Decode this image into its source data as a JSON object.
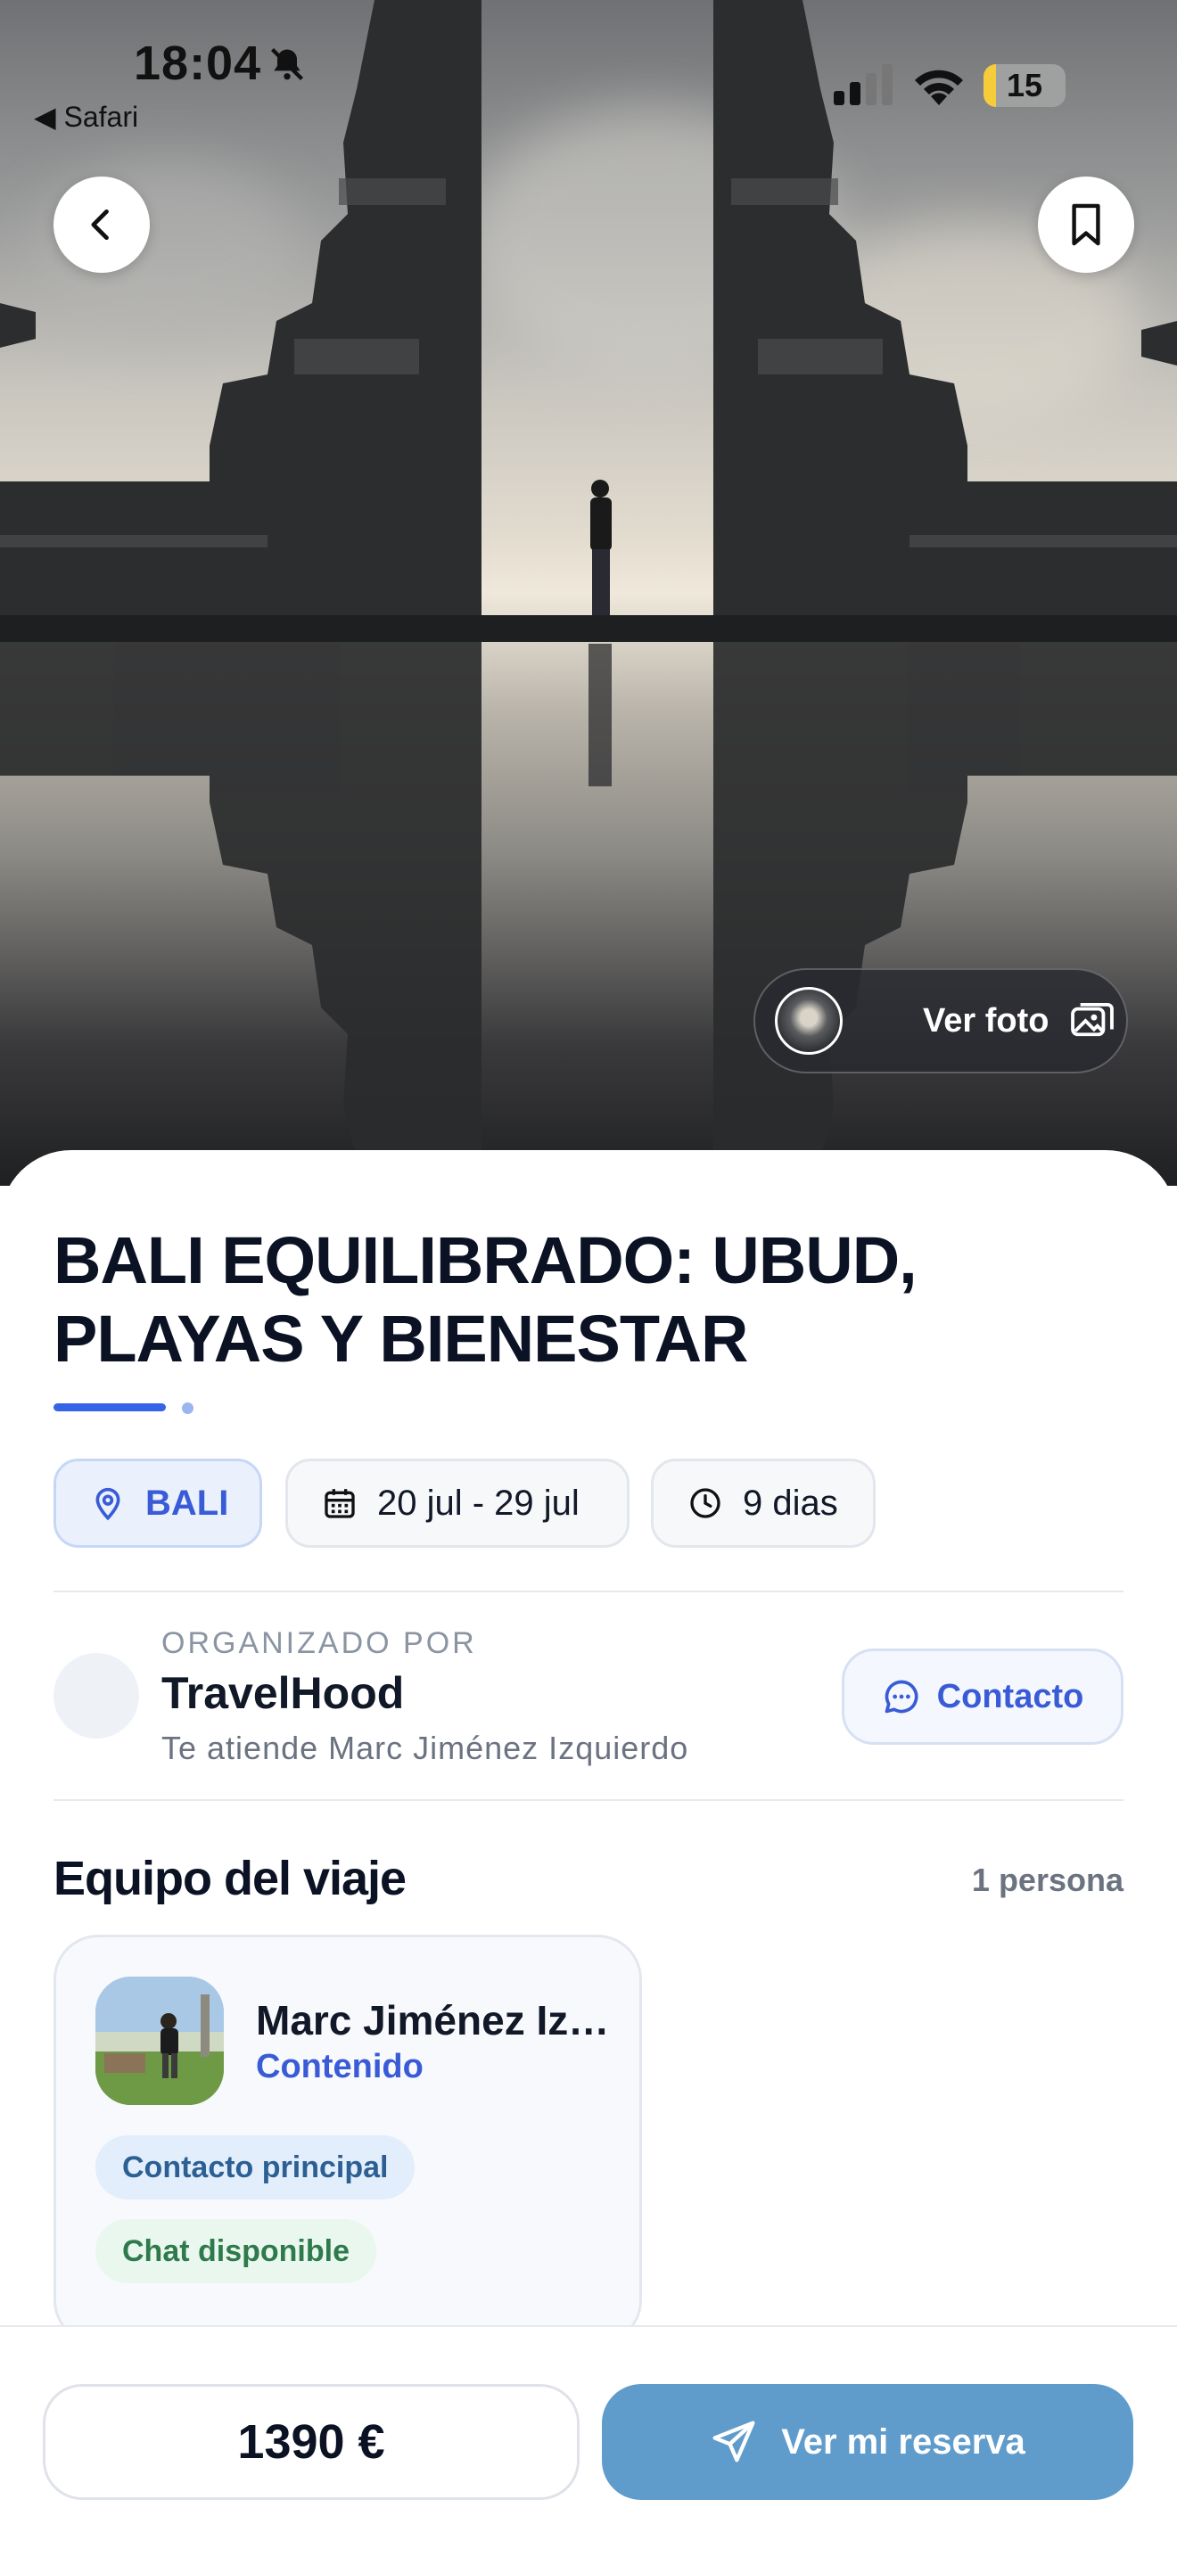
{
  "status_bar": {
    "time": "18:04",
    "back_app": "◀ Safari",
    "battery": "15",
    "battery_level": 0.15
  },
  "hero": {
    "photo_button_label": "Ver foto"
  },
  "trip": {
    "title": "BALI EQUILIBRADO: UBUD, PLAYAS Y BIENESTAR",
    "location": "BALI",
    "dates": "20 jul - 29 jul",
    "duration": "9 dias"
  },
  "organizer": {
    "kicker": "ORGANIZADO POR",
    "name": "TravelHood",
    "attended_by": "Te atiende Marc Jiménez Izquierdo",
    "contact_label": "Contacto"
  },
  "team": {
    "heading": "Equipo del viaje",
    "count": "1 persona",
    "members": [
      {
        "name": "Marc Jiménez Izquierdo",
        "role": "Contenido",
        "badges": [
          "Contacto principal",
          "Chat disponible"
        ]
      }
    ]
  },
  "footer": {
    "price": "1390 €",
    "reserve_label": "Ver mi reserva"
  },
  "colors": {
    "accent": "#3a5bd6",
    "reserve_button": "#5f9ccc",
    "chip_location_bg": "#eaf1fd",
    "badge_primary_bg": "#e3eefc",
    "badge_chat_bg": "#e9f7ee"
  },
  "icons": {
    "back": "chevron-left-icon",
    "bookmark": "bookmark-icon",
    "photo": "image-icon",
    "location": "map-pin-icon",
    "calendar": "calendar-icon",
    "clock": "clock-icon",
    "chat": "chat-bubble-icon",
    "send": "paper-plane-icon"
  }
}
